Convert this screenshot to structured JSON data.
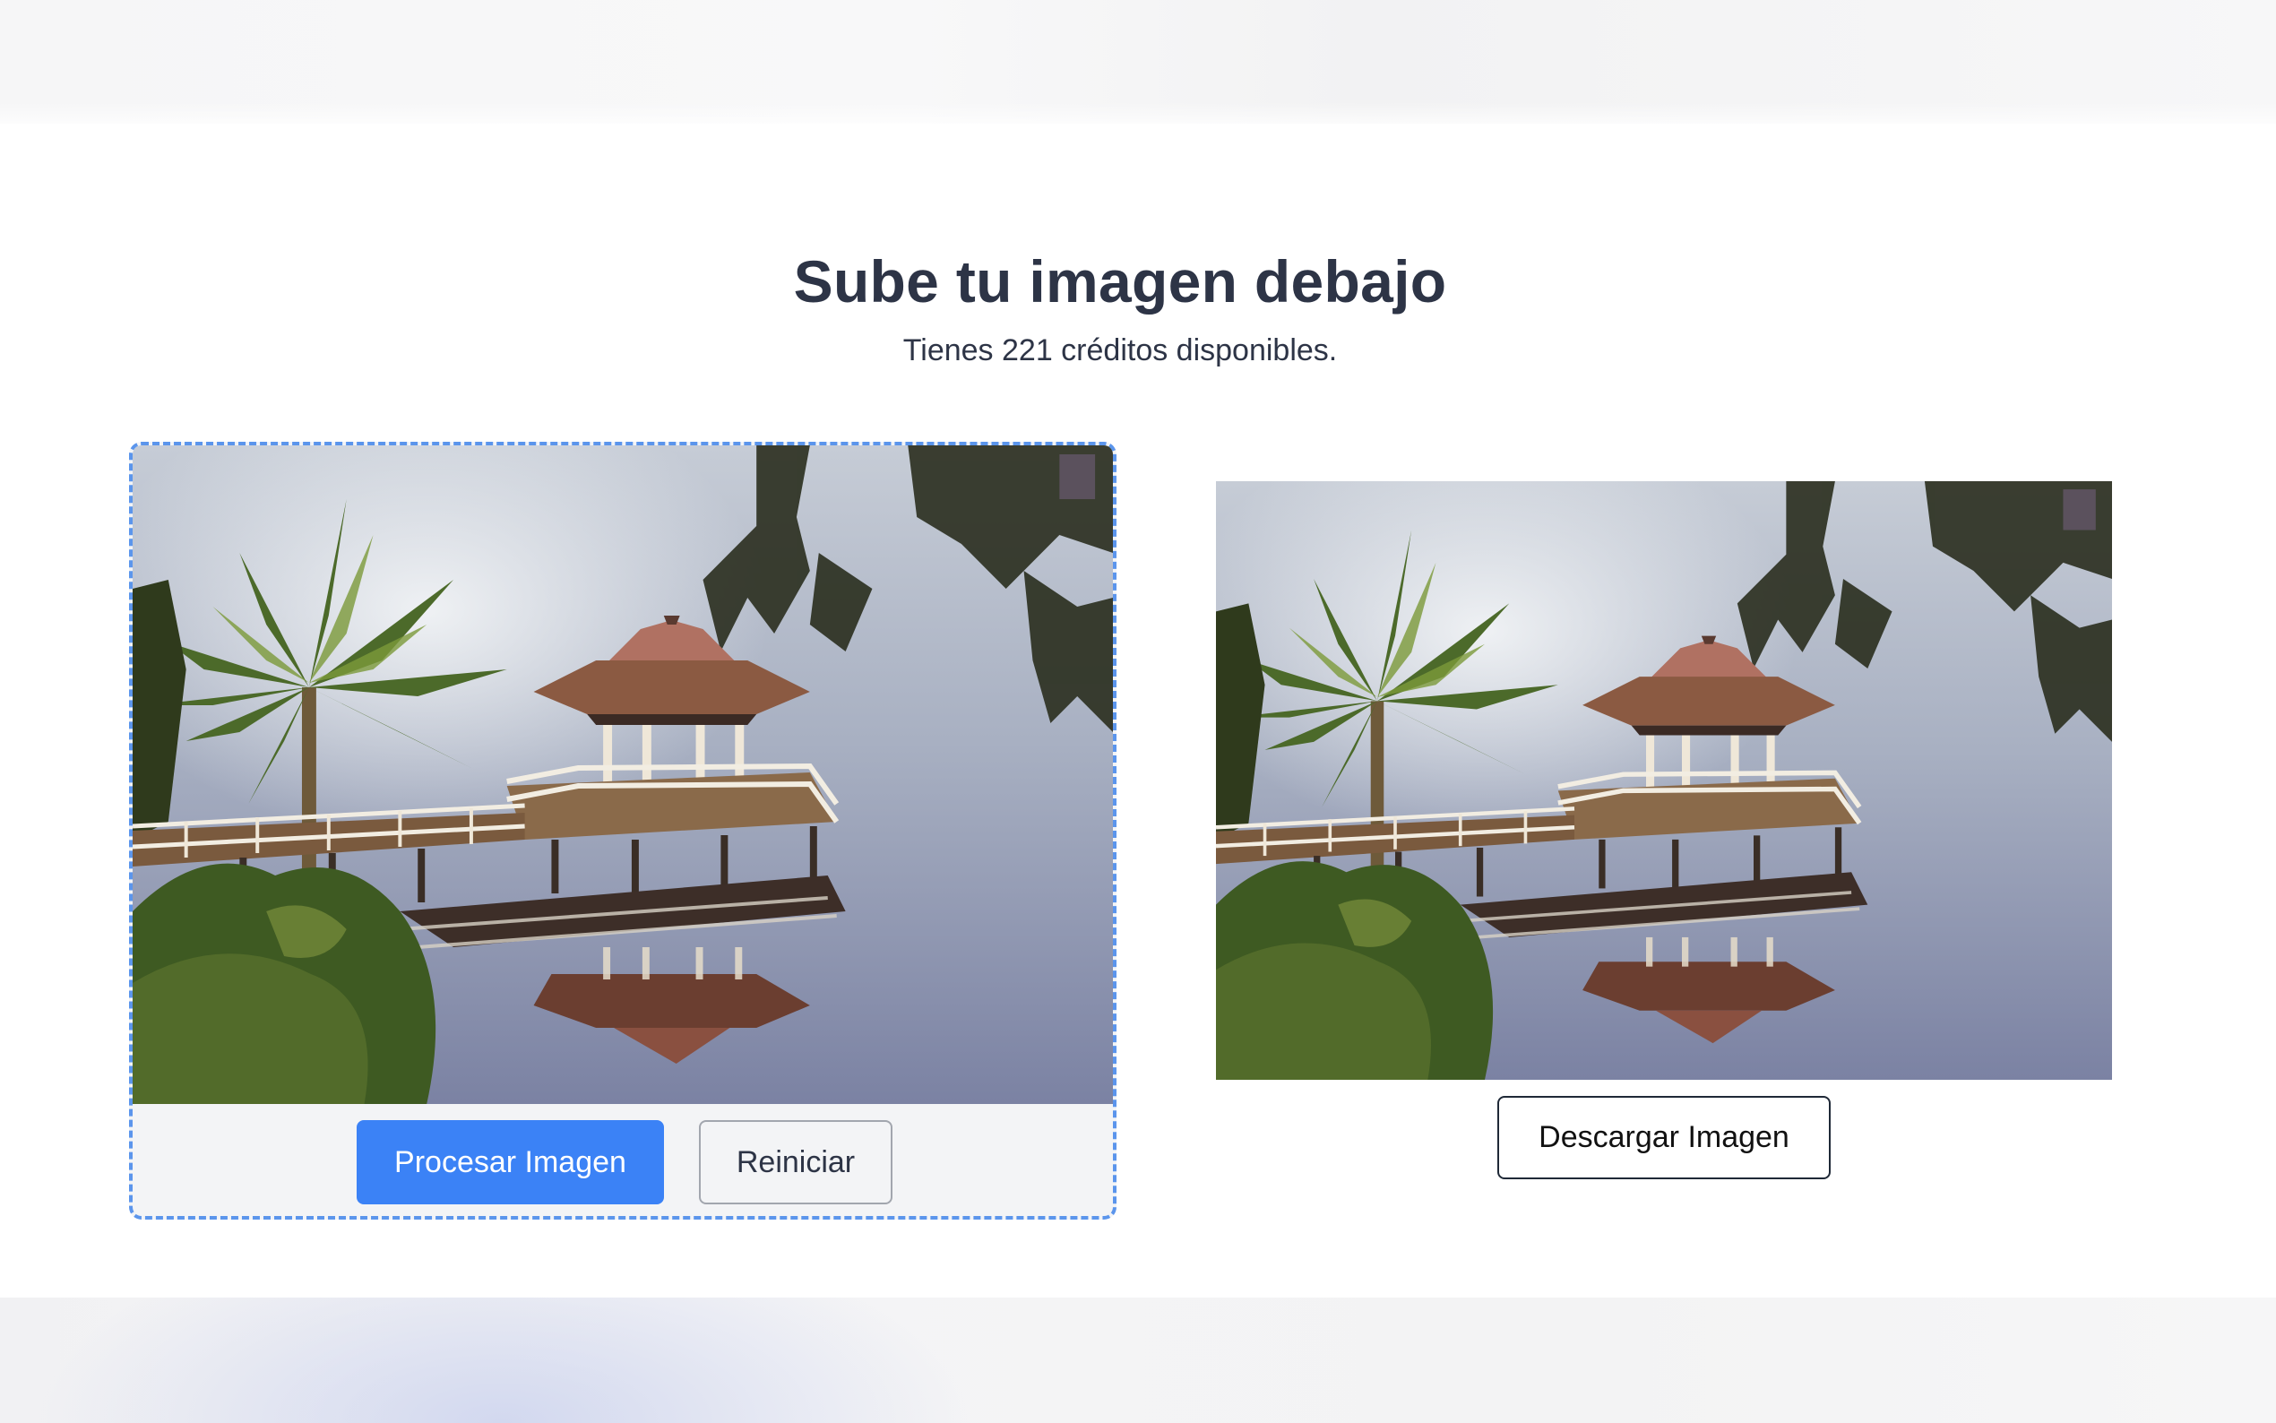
{
  "header": {
    "title": "Sube tu imagen debajo",
    "credits": "Tienes 221 créditos disponibles."
  },
  "upload_panel": {
    "image_alt": "Palmera y pérgola junto a un lago",
    "process_label": "Procesar Imagen",
    "reset_label": "Reiniciar"
  },
  "result_panel": {
    "image_alt": "Imagen procesada: palmera y pérgola junto a un lago",
    "download_label": "Descargar Imagen"
  },
  "colors": {
    "accent": "#3b82f6",
    "dashed_border": "#5b95ec",
    "title_text": "#2d3446",
    "panel_bg": "#f3f4f6"
  }
}
